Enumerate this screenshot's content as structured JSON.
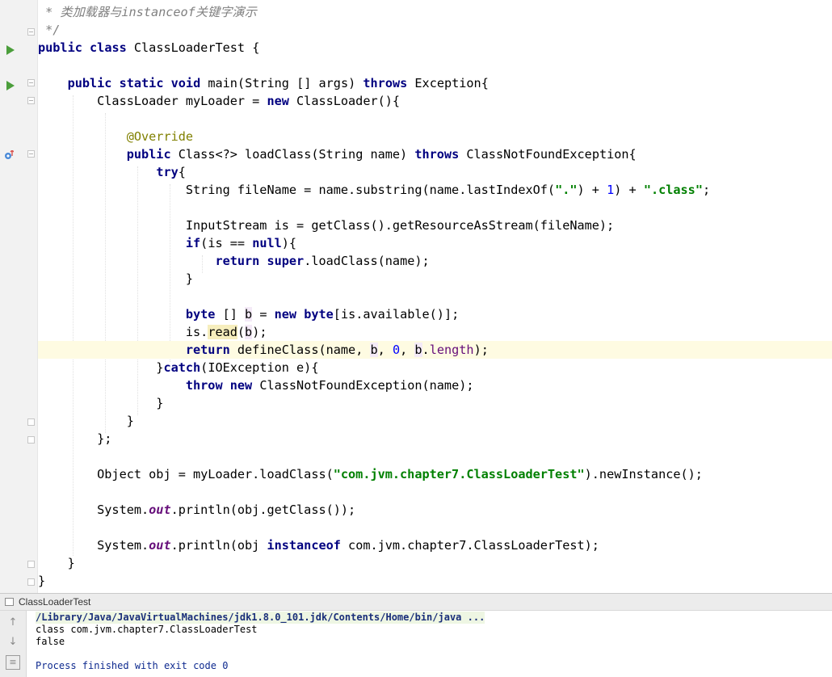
{
  "editor": {
    "current_line_index": 15,
    "lines": [
      [
        {
          "t": " * 类加载器与",
          "c": "cmt"
        },
        {
          "t": "instanceof",
          "c": "cmt"
        },
        {
          "t": "关键字演示",
          "c": "cmt"
        }
      ],
      [
        {
          "t": " */",
          "c": "cmt"
        }
      ],
      [
        {
          "t": "public",
          "c": "kw"
        },
        {
          "t": " "
        },
        {
          "t": "class",
          "c": "kw"
        },
        {
          "t": " ClassLoaderTest {"
        }
      ],
      [],
      [
        {
          "t": "    "
        },
        {
          "t": "public",
          "c": "kw"
        },
        {
          "t": " "
        },
        {
          "t": "static",
          "c": "kw"
        },
        {
          "t": " "
        },
        {
          "t": "void",
          "c": "kw"
        },
        {
          "t": " main(String [] args) "
        },
        {
          "t": "throws",
          "c": "kw"
        },
        {
          "t": " Exception{"
        }
      ],
      [
        {
          "t": "        ClassLoader myLoader = "
        },
        {
          "t": "new",
          "c": "kw"
        },
        {
          "t": " ClassLoader(){"
        }
      ],
      [],
      [
        {
          "t": "            "
        },
        {
          "t": "@Override",
          "c": "ann"
        }
      ],
      [
        {
          "t": "            "
        },
        {
          "t": "public",
          "c": "kw"
        },
        {
          "t": " Class<?> loadClass(String name) "
        },
        {
          "t": "throws",
          "c": "kw"
        },
        {
          "t": " ClassNotFoundException{"
        }
      ],
      [
        {
          "t": "                "
        },
        {
          "t": "try",
          "c": "kw"
        },
        {
          "t": "{"
        }
      ],
      [
        {
          "t": "                    String fileName = name.substring(name.lastIndexOf("
        },
        {
          "t": "\".\"",
          "c": "str"
        },
        {
          "t": ") + "
        },
        {
          "t": "1",
          "c": "num"
        },
        {
          "t": ") + "
        },
        {
          "t": "\".class\"",
          "c": "str"
        },
        {
          "t": ";"
        }
      ],
      [],
      [
        {
          "t": "                    InputStream is = getClass().getResourceAsStream(fileName);"
        }
      ],
      [
        {
          "t": "                    "
        },
        {
          "t": "if",
          "c": "kw"
        },
        {
          "t": "(is == "
        },
        {
          "t": "null",
          "c": "kw"
        },
        {
          "t": "){"
        }
      ],
      [
        {
          "t": "                        "
        },
        {
          "t": "return",
          "c": "kw"
        },
        {
          "t": " "
        },
        {
          "t": "super",
          "c": "kw"
        },
        {
          "t": ".loadClass(name);"
        }
      ],
      [
        {
          "t": "                    }"
        }
      ],
      [],
      [
        {
          "t": "                    "
        },
        {
          "t": "byte",
          "c": "kw"
        },
        {
          "t": " [] "
        },
        {
          "t": "b",
          "c": "usage"
        },
        {
          "t": " = "
        },
        {
          "t": "new",
          "c": "kw"
        },
        {
          "t": " "
        },
        {
          "t": "byte",
          "c": "kw"
        },
        {
          "t": "[is.available()];"
        }
      ],
      [
        {
          "t": "                    is."
        },
        {
          "t": "read",
          "c": "readhl"
        },
        {
          "t": "("
        },
        {
          "t": "b",
          "c": "usage"
        },
        {
          "t": ");"
        }
      ],
      [
        {
          "t": "                    "
        },
        {
          "t": "return",
          "c": "kw"
        },
        {
          "t": " defineClass(name, "
        },
        {
          "t": "b",
          "c": "usage"
        },
        {
          "t": ", "
        },
        {
          "t": "0",
          "c": "num"
        },
        {
          "t": ", "
        },
        {
          "t": "b",
          "c": "usage"
        },
        {
          "t": "."
        },
        {
          "t": "length",
          "c": "fld2"
        },
        {
          "t": ");"
        }
      ],
      [
        {
          "t": "                }"
        },
        {
          "t": "catch",
          "c": "kw"
        },
        {
          "t": "(IOException e){"
        }
      ],
      [
        {
          "t": "                    "
        },
        {
          "t": "throw",
          "c": "kw"
        },
        {
          "t": " "
        },
        {
          "t": "new",
          "c": "kw"
        },
        {
          "t": " ClassNotFoundException(name);"
        }
      ],
      [
        {
          "t": "                }"
        }
      ],
      [
        {
          "t": "            }"
        }
      ],
      [
        {
          "t": "        };"
        }
      ],
      [],
      [
        {
          "t": "        Object obj = myLoader.loadClass("
        },
        {
          "t": "\"com.jvm.chapter7.ClassLoaderTest\"",
          "c": "str"
        },
        {
          "t": ").newInstance();"
        }
      ],
      [],
      [
        {
          "t": "        System."
        },
        {
          "t": "out",
          "c": "fld"
        },
        {
          "t": ".println(obj.getClass());"
        }
      ],
      [],
      [
        {
          "t": "        System."
        },
        {
          "t": "out",
          "c": "fld"
        },
        {
          "t": ".println(obj "
        },
        {
          "t": "instanceof",
          "c": "kw"
        },
        {
          "t": " com.jvm.chapter7.ClassLoaderTest);"
        }
      ],
      [
        {
          "t": "    }"
        }
      ],
      [
        {
          "t": "}"
        }
      ]
    ]
  },
  "run_tool_window": {
    "tab_label": "ClassLoaderTest",
    "output": {
      "command": "/Library/Java/JavaVirtualMachines/jdk1.8.0_101.jdk/Contents/Home/bin/java ...",
      "line1": "class com.jvm.chapter7.ClassLoaderTest",
      "line2": "false",
      "exit": "Process finished with exit code 0"
    },
    "tools": [
      "up-arrow-icon",
      "down-arrow-icon",
      "soft-wrap-icon"
    ]
  },
  "colors": {
    "keyword": "#000080",
    "string": "#008000",
    "number": "#0000ff",
    "comment": "#808080",
    "annotation": "#808000",
    "current_line": "#fefbe2",
    "run_icon": "#4b9e3b"
  }
}
